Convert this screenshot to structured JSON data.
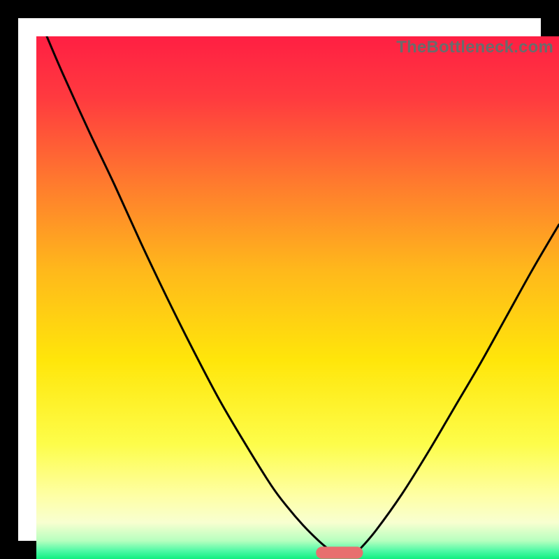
{
  "watermark": "TheBottleneck.com",
  "chart_data": {
    "type": "line",
    "title": "",
    "xlabel": "",
    "ylabel": "",
    "xlim": [
      0,
      100
    ],
    "ylim": [
      0,
      100
    ],
    "background_gradient_stops": [
      {
        "offset": 0.0,
        "color": "#ff1f43"
      },
      {
        "offset": 0.12,
        "color": "#ff3b3f"
      },
      {
        "offset": 0.28,
        "color": "#ff7a2e"
      },
      {
        "offset": 0.45,
        "color": "#ffb91b"
      },
      {
        "offset": 0.62,
        "color": "#ffe60a"
      },
      {
        "offset": 0.78,
        "color": "#fdfd4a"
      },
      {
        "offset": 0.88,
        "color": "#feffa6"
      },
      {
        "offset": 0.93,
        "color": "#f8ffd0"
      },
      {
        "offset": 0.965,
        "color": "#b7ffbf"
      },
      {
        "offset": 0.985,
        "color": "#4cf9a5"
      },
      {
        "offset": 1.0,
        "color": "#11ef80"
      }
    ],
    "marker": {
      "color": "#e86f6f",
      "x": 58,
      "y": 1.2,
      "width_pct": 9,
      "height_pct": 2.3,
      "rx_pct": 1.15
    },
    "series": [
      {
        "name": "left-curve",
        "x": [
          2.0,
          5,
          10,
          15,
          20,
          25,
          30,
          35,
          40,
          45,
          48,
          51,
          54,
          56,
          57.5
        ],
        "y": [
          100,
          93,
          82,
          71.5,
          60.5,
          50,
          40,
          30.5,
          22,
          14,
          10,
          6.5,
          3.5,
          1.8,
          0.7
        ]
      },
      {
        "name": "right-curve",
        "x": [
          60.5,
          62,
          65,
          70,
          75,
          80,
          85,
          90,
          95,
          100
        ],
        "y": [
          0.7,
          2.0,
          5.5,
          12.5,
          20.5,
          29,
          37.5,
          46.5,
          55.5,
          64
        ]
      }
    ]
  }
}
